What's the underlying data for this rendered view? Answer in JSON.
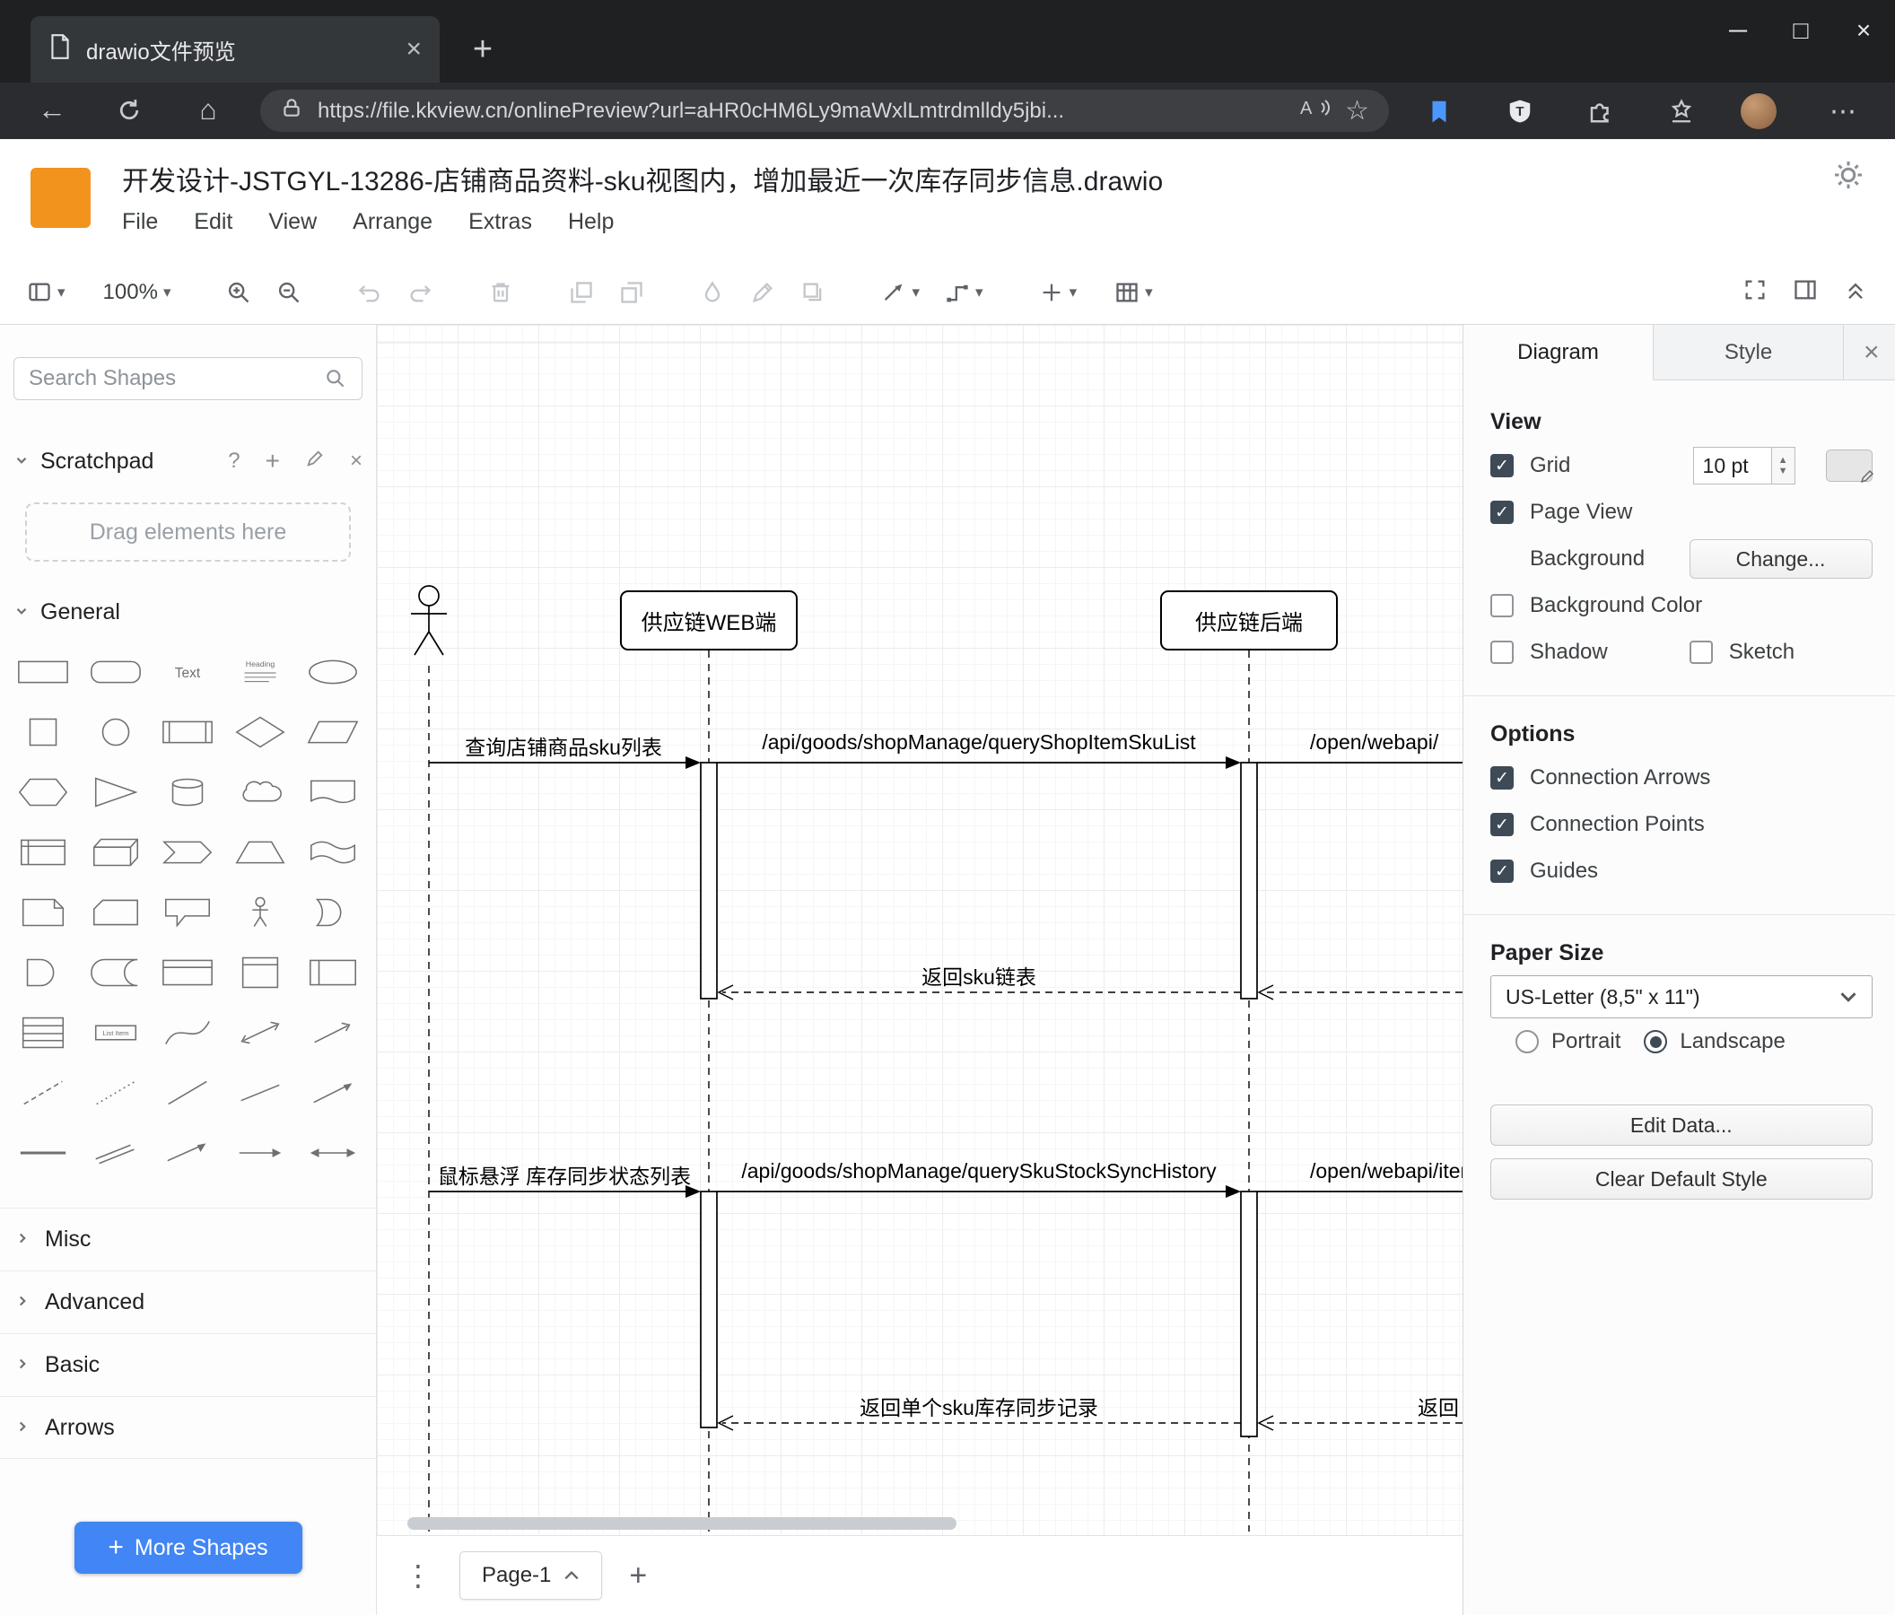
{
  "colors": {
    "accent_blue": "#4285f4",
    "logo_orange": "#f2931e",
    "checkbox_dark": "#3e4a56"
  },
  "browser": {
    "tab_title": "drawio文件预览",
    "url": "https://file.kkview.cn/onlinePreview?url=aHR0cHM6Ly9maWxlLmtrdmlldy5jbi..."
  },
  "app": {
    "title": "开发设计-JSTGYL-13286-店铺商品资料-sku视图内，增加最近一次库存同步信息.drawio",
    "menus": [
      "File",
      "Edit",
      "View",
      "Arrange",
      "Extras",
      "Help"
    ],
    "zoom_level": "100%"
  },
  "shapes": {
    "search_placeholder": "Search Shapes",
    "scratchpad_label": "Scratchpad",
    "scratchpad_hint": "Drag elements here",
    "sections": [
      "General",
      "Misc",
      "Advanced",
      "Basic",
      "Arrows"
    ],
    "general_shapes": [
      "rectangle",
      "rounded-rectangle",
      "text",
      "textbox",
      "ellipse",
      "square",
      "circle",
      "process",
      "diamond",
      "parallelogram",
      "hexagon",
      "triangle",
      "cylinder",
      "cloud",
      "document",
      "internal-storage",
      "cube",
      "step",
      "trapezoid",
      "tape",
      "note",
      "card",
      "callout",
      "actor",
      "or",
      "and",
      "data-storage",
      "container",
      "vertical-container",
      "horizontal-container",
      "list",
      "list-item",
      "curve",
      "bidirectional-arrow",
      "arrow",
      "dashed-line",
      "dotted-line",
      "line",
      "bidirectional-connector",
      "directional-connector",
      "horizontal-line",
      "link",
      "arrow-link",
      "simple-arrow",
      "simple-double-arrow"
    ],
    "more_shapes_label": "More Shapes"
  },
  "diagram": {
    "participants": [
      {
        "label": "供应链WEB端"
      },
      {
        "label": "供应链后端"
      }
    ],
    "messages": [
      {
        "label": "查询店铺商品sku列表",
        "type": "solid"
      },
      {
        "label": "/api/goods/shopManage/queryShopItemSkuList",
        "type": "solid"
      },
      {
        "label": "/open/webapi/",
        "type": "solid"
      },
      {
        "label": "返回sku链表",
        "type": "dashed-return"
      },
      {
        "label": "鼠标悬浮 库存同步状态列表",
        "type": "solid"
      },
      {
        "label": "/api/goods/shopManage/querySkuStockSyncHistory",
        "type": "solid"
      },
      {
        "label": "/open/webapi/iten",
        "type": "solid"
      },
      {
        "label": "返回单个sku库存同步记录",
        "type": "dashed-return"
      },
      {
        "label": "返回",
        "type": "dashed-return"
      }
    ]
  },
  "footer": {
    "page_tab": "Page-1"
  },
  "format": {
    "tabs": [
      "Diagram",
      "Style"
    ],
    "view": {
      "heading": "View",
      "grid_label": "Grid",
      "grid_size": "10 pt",
      "page_view_label": "Page View",
      "background_label": "Background",
      "change_button": "Change...",
      "background_color_label": "Background Color",
      "shadow_label": "Shadow",
      "sketch_label": "Sketch"
    },
    "options": {
      "heading": "Options",
      "connection_arrows_label": "Connection Arrows",
      "connection_points_label": "Connection Points",
      "guides_label": "Guides"
    },
    "paper": {
      "heading": "Paper Size",
      "size_value": "US-Letter (8,5\" x 11\")",
      "portrait_label": "Portrait",
      "landscape_label": "Landscape"
    },
    "edit_data_button": "Edit Data...",
    "clear_default_style_button": "Clear Default Style"
  }
}
